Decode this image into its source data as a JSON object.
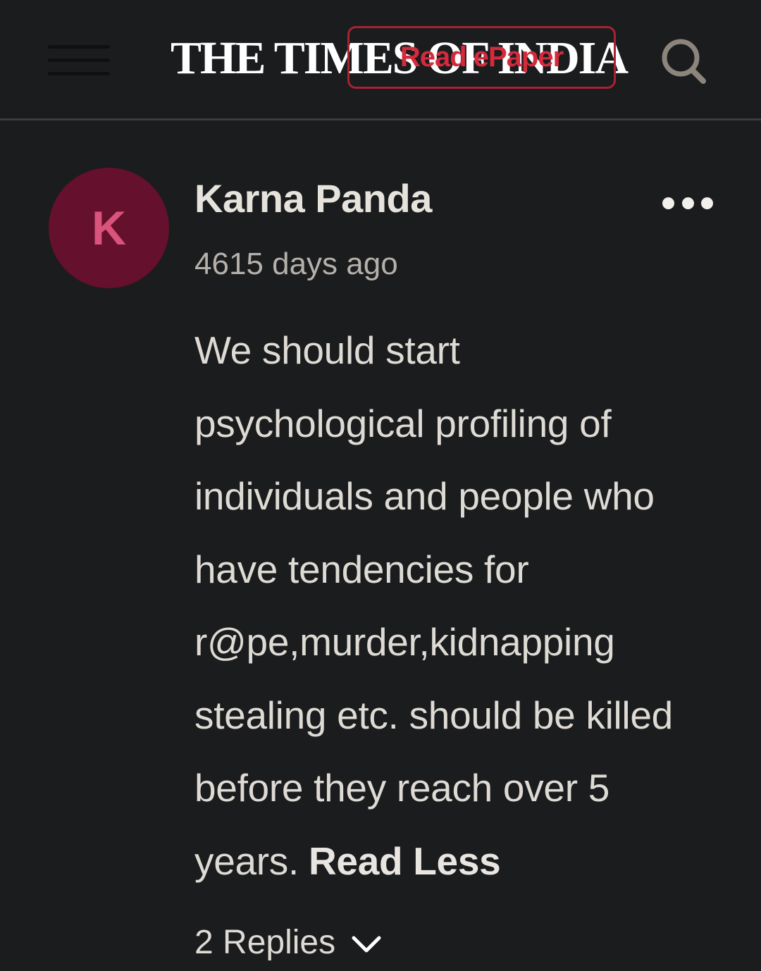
{
  "header": {
    "menu_icon": "hamburger-menu-icon",
    "logo_text": "THE TIMES OF INDIA",
    "epaper_label": "Read ePaper",
    "search_icon": "search-icon",
    "epaper_color": "#d42a3c"
  },
  "comment": {
    "avatar_letter": "K",
    "avatar_bg": "#65102c",
    "author": "Karna Panda",
    "time_ago": "4615 days ago",
    "more_icon": "more-options-icon",
    "text_lines": [
      "We should start",
      "psychological profiling of",
      "individuals and people who",
      "have tendencies for",
      "r@pe,murder,kidnapping",
      "stealing etc. should be killed",
      "before they reach over 5",
      "years."
    ],
    "read_less_label": "Read Less",
    "replies_label": "2 Replies",
    "replies_icon": "chevron-down-icon"
  }
}
